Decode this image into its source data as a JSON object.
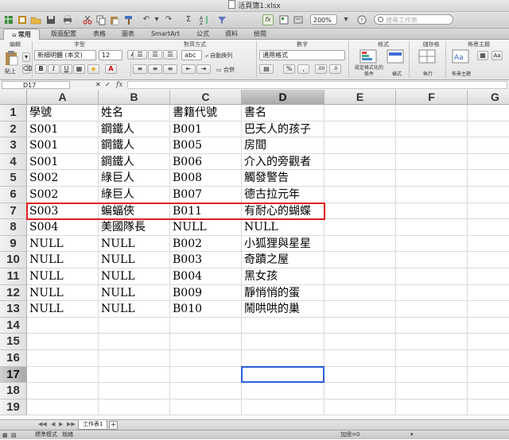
{
  "window": {
    "title": "活頁簿1.xlsx"
  },
  "toolbar": {
    "zoom": "200%",
    "search_placeholder": "搜尋工作表"
  },
  "ribbon_tabs": [
    "常用",
    "版面配置",
    "表格",
    "圖表",
    "SmartArt",
    "公式",
    "資料",
    "檢閱"
  ],
  "ribbon": {
    "groups": [
      "編輯",
      "字型",
      "對齊方式",
      "數字",
      "格式",
      "儲存格",
      "佈景主題"
    ],
    "paste_label": "貼上",
    "font_name": "新細明體 (本文)",
    "font_size": "12",
    "wrap_label": "自動換列",
    "merge_label": "合併",
    "number_format": "通用格式",
    "conditional_format_label": "設定格式化的條件",
    "style_label": "樣式",
    "execute_label": "執行",
    "theme_label": "佈景主題",
    "abc_label": "abc"
  },
  "formula_bar": {
    "name_box": "D17",
    "fx": "fx",
    "formula": ""
  },
  "sheet": {
    "columns": [
      "A",
      "B",
      "C",
      "D",
      "E",
      "F",
      "G"
    ],
    "selected_column": "D",
    "selected_row": "17",
    "rows": [
      {
        "num": "1",
        "cells": [
          "學號",
          "姓名",
          "書籍代號",
          "書名"
        ]
      },
      {
        "num": "2",
        "cells": [
          "S001",
          "鋼鐵人",
          "B001",
          "巴夭人的孩子"
        ]
      },
      {
        "num": "3",
        "cells": [
          "S001",
          "鋼鐵人",
          "B005",
          "房間"
        ]
      },
      {
        "num": "4",
        "cells": [
          "S001",
          "鋼鐵人",
          "B006",
          "介入的旁觀者"
        ]
      },
      {
        "num": "5",
        "cells": [
          "S002",
          "綠巨人",
          "B008",
          "觸發警告"
        ]
      },
      {
        "num": "6",
        "cells": [
          "S002",
          "綠巨人",
          "B007",
          "德古拉元年"
        ]
      },
      {
        "num": "7",
        "cells": [
          "S003",
          "蝙蝠俠",
          "B011",
          "有耐心的蝴蝶"
        ]
      },
      {
        "num": "8",
        "cells": [
          "S004",
          "美國隊長",
          "NULL",
          "NULL"
        ]
      },
      {
        "num": "9",
        "cells": [
          "NULL",
          "NULL",
          "B002",
          "小狐狸與星星"
        ]
      },
      {
        "num": "10",
        "cells": [
          "NULL",
          "NULL",
          "B003",
          "奇蹟之屋"
        ]
      },
      {
        "num": "11",
        "cells": [
          "NULL",
          "NULL",
          "B004",
          "黑女孩"
        ]
      },
      {
        "num": "12",
        "cells": [
          "NULL",
          "NULL",
          "B009",
          "靜悄悄的蛋"
        ]
      },
      {
        "num": "13",
        "cells": [
          "NULL",
          "NULL",
          "B010",
          "鬧哄哄的巢"
        ]
      },
      {
        "num": "14",
        "cells": [
          "",
          "",
          "",
          ""
        ]
      },
      {
        "num": "15",
        "cells": [
          "",
          "",
          "",
          ""
        ]
      },
      {
        "num": "16",
        "cells": [
          "",
          "",
          "",
          ""
        ]
      },
      {
        "num": "17",
        "cells": [
          "",
          "",
          "",
          ""
        ]
      },
      {
        "num": "18",
        "cells": [
          "",
          "",
          "",
          ""
        ]
      },
      {
        "num": "19",
        "cells": [
          "",
          "",
          "",
          ""
        ]
      }
    ]
  },
  "sheet_tabs": [
    "工作表1"
  ],
  "status": {
    "view_mode": "標準模式",
    "ready": "就緒",
    "sum": "加總=0"
  },
  "colors": {
    "highlight_row": "#e01e1e",
    "selection": "#2b5fd9",
    "ribbon_accent": "#6a9b3f"
  }
}
